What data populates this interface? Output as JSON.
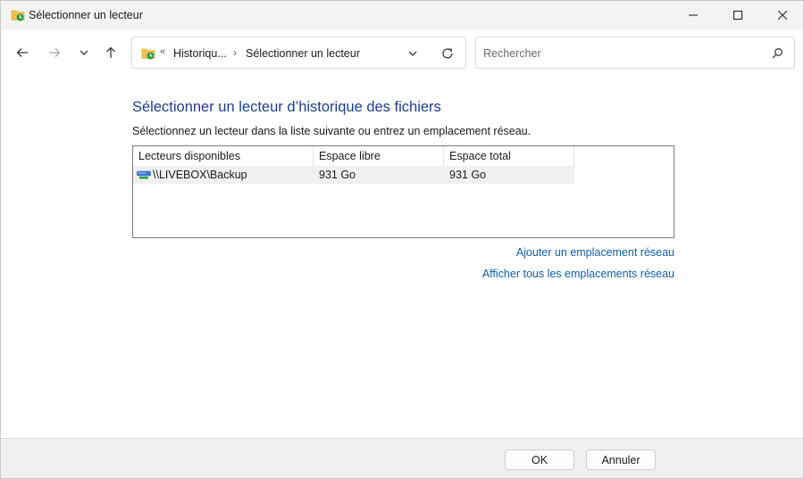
{
  "window": {
    "title": "Sélectionner un lecteur",
    "icon": "file-history-icon",
    "controls": [
      "minimize-icon",
      "maximize-icon",
      "close-icon"
    ]
  },
  "navigation": {
    "back_icon": "arrow-left-icon",
    "forward_icon": "arrow-right-icon",
    "recent_icon": "chevron-down-icon",
    "up_icon": "arrow-up-icon",
    "address": {
      "overflow": "«",
      "segments": [
        "Historiqu...",
        "Sélectionner un lecteur"
      ],
      "separator": "›"
    },
    "search": {
      "placeholder": "Rechercher",
      "value": ""
    }
  },
  "main": {
    "title": "Sélectionner un lecteur d’historique des fichiers",
    "instructions": "Sélectionnez un lecteur dans la liste suivante ou entrez un emplacement réseau.",
    "table": {
      "columns": [
        "Lecteurs disponibles",
        "Espace libre",
        "Espace total"
      ],
      "rows": [
        {
          "icon": "network-drive-icon",
          "name": "\\\\LIVEBOX\\Backup",
          "free": "931 Go",
          "total": "931 Go"
        }
      ]
    },
    "links": {
      "add_network": "Ajouter un emplacement réseau",
      "show_all": "Afficher tous les emplacements réseau"
    }
  },
  "footer": {
    "ok_label": "OK",
    "cancel_label": "Annuler"
  },
  "colors": {
    "title_blue": "#1e3d8f",
    "link_blue": "#0f5fa8",
    "selection_gray": "#f0f0f0"
  }
}
